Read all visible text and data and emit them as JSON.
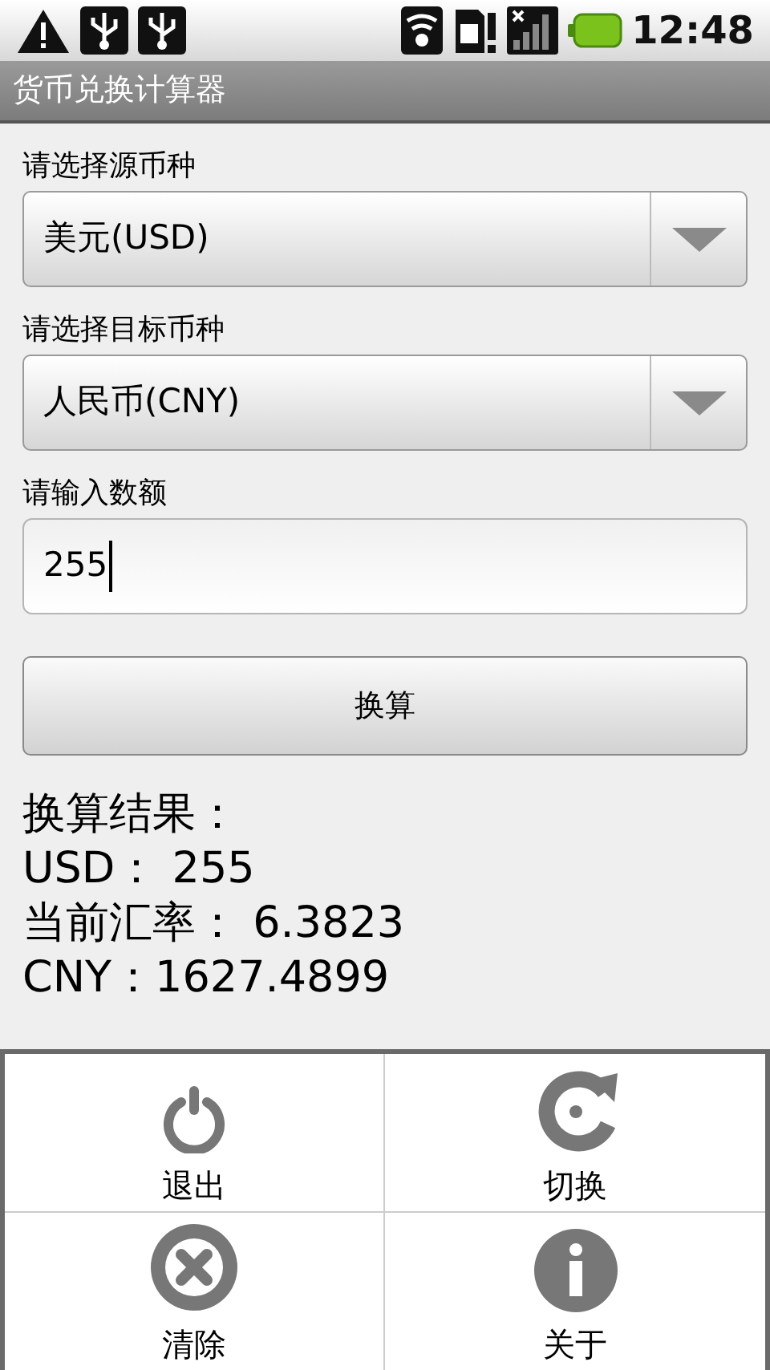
{
  "status_bar": {
    "time": "12:48"
  },
  "window": {
    "title": "货币兑换计算器"
  },
  "form": {
    "source_label": "请选择源币种",
    "source_value": "美元(USD)",
    "target_label": "请选择目标币种",
    "target_value": "人民币(CNY)",
    "amount_label": "请输入数额",
    "amount_value": "255",
    "convert_button": "换算"
  },
  "result": {
    "lines": [
      "换算结果：",
      "USD： 255",
      "当前汇率： 6.3823",
      "CNY：1627.4899"
    ]
  },
  "menu": {
    "items": [
      {
        "kind": "power",
        "label": "退出"
      },
      {
        "kind": "refresh",
        "label": "切换"
      },
      {
        "kind": "clear",
        "label": "清除"
      },
      {
        "kind": "info",
        "label": "关于"
      }
    ]
  }
}
